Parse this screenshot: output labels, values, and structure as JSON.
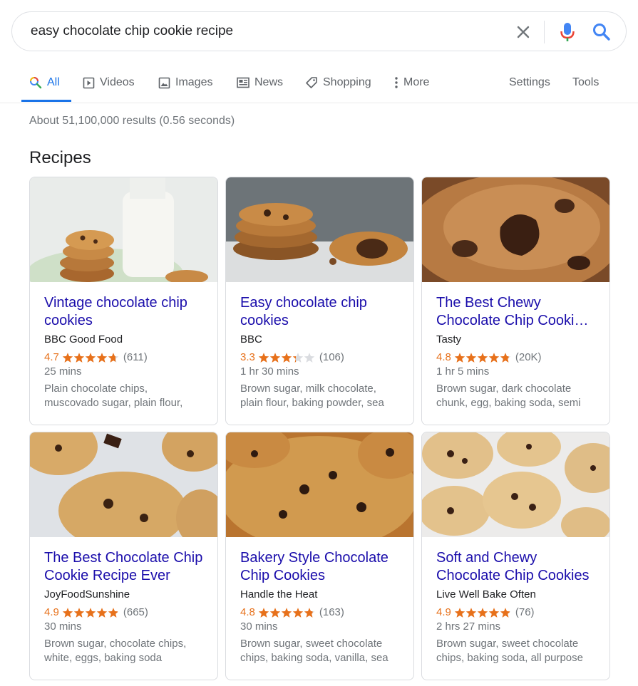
{
  "search": {
    "query": "easy chocolate chip cookie recipe"
  },
  "tabs": [
    {
      "label": "All",
      "icon": "search-icon"
    },
    {
      "label": "Videos",
      "icon": "video-icon"
    },
    {
      "label": "Images",
      "icon": "image-icon"
    },
    {
      "label": "News",
      "icon": "news-icon"
    },
    {
      "label": "Shopping",
      "icon": "tag-icon"
    },
    {
      "label": "More",
      "icon": "more-vertical-icon"
    },
    {
      "label": "Settings"
    },
    {
      "label": "Tools"
    }
  ],
  "results_stats": "About 51,100,000 results (0.56 seconds)",
  "section_heading": "Recipes",
  "colors": {
    "link": "#1a0dab",
    "rating": "#e7711b",
    "accent": "#1a73e8",
    "muted": "#70757a"
  },
  "recipes": [
    {
      "title": "Vintage chocolate chip cookies",
      "source": "BBC Good Food",
      "rating": "4.7",
      "stars": 4.7,
      "count": "(611)",
      "time": "25 mins",
      "ingredients": "Plain chocolate chips, muscovado sugar, plain flour,"
    },
    {
      "title": "Easy chocolate chip cookies",
      "source": "BBC",
      "rating": "3.3",
      "stars": 3.3,
      "count": "(106)",
      "time": "1 hr 30 mins",
      "ingredients": "Brown sugar, milk chocolate, plain flour, baking powder, sea"
    },
    {
      "title": "The Best Chewy Chocolate Chip Cooki…",
      "source": "Tasty",
      "rating": "4.8",
      "stars": 4.8,
      "count": "(20K)",
      "time": "1 hr 5 mins",
      "ingredients": "Brown sugar, dark chocolate chunk, egg, baking soda, semi"
    },
    {
      "title": "The Best Chocolate Chip Cookie Recipe Ever",
      "source": "JoyFoodSunshine",
      "rating": "4.9",
      "stars": 4.9,
      "count": "(665)",
      "time": "30 mins",
      "ingredients": "Brown sugar, chocolate chips, white, eggs, baking soda"
    },
    {
      "title": "Bakery Style Chocolate Chip Cookies",
      "source": "Handle the Heat",
      "rating": "4.8",
      "stars": 4.8,
      "count": "(163)",
      "time": "30 mins",
      "ingredients": "Brown sugar, sweet chocolate chips, baking soda, vanilla, sea"
    },
    {
      "title": "Soft and Chewy Chocolate Chip Cookies",
      "source": "Live Well Bake Often",
      "rating": "4.9",
      "stars": 4.9,
      "count": "(76)",
      "time": "2 hrs 27 mins",
      "ingredients": "Brown sugar, sweet chocolate chips, baking soda, all purpose"
    }
  ]
}
